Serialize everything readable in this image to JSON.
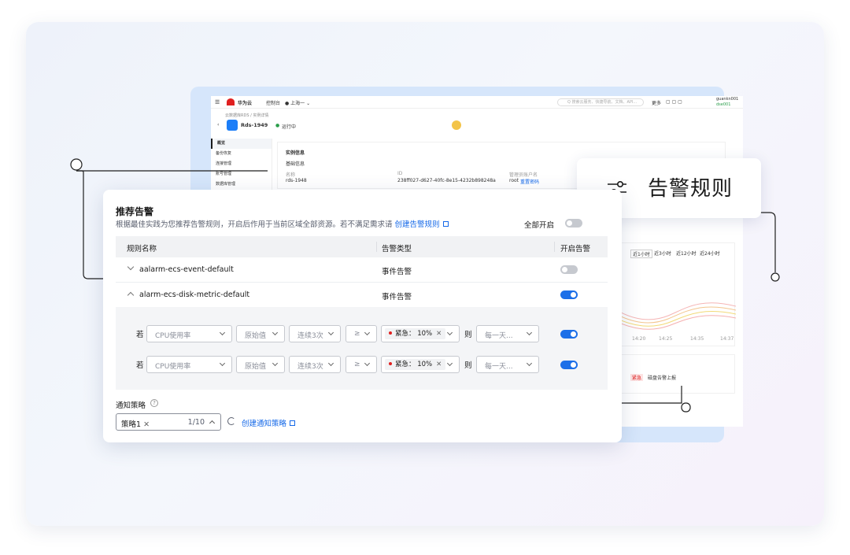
{
  "console": {
    "brand": "华为云",
    "nav_console": "控制台",
    "region": "上海一",
    "search_placeholder": "Q 搜索云服务、快捷导航、文档、API...",
    "more": "更多",
    "user_name": "guankn001",
    "user_sub": "dse001",
    "breadcrumb": "云数据库RDS / 实例详情",
    "instance_name": "Rds-1949",
    "status": "运行中",
    "sidebar": [
      "概览",
      "备份恢复",
      "连接管理",
      "账号管理",
      "数据库管理"
    ],
    "section_title": "实例信息",
    "subsection": "基础信息",
    "field_name_label": "名称",
    "field_name_value": "rds-1948",
    "field_id_label": "ID",
    "field_id_value": "238ff027-d627-40fc-8e15-4232b898248a",
    "field_admin_label": "管理员账户名",
    "field_admin_value": "root",
    "reset_pwd": "重置密码",
    "chart_tabs": [
      "近1小时",
      "近3小时",
      "近12小时",
      "近24小时"
    ],
    "chart_ticks": [
      "14:20",
      "14:25",
      "14:35",
      "14:37"
    ],
    "event_tag": "紧急",
    "event_text": "磁盘告警上报"
  },
  "callout": {
    "label": "告警规则",
    "icon": "sliders-icon"
  },
  "panel": {
    "title": "推荐告警",
    "description": "根据最佳实践为您推荐告警规则，开启后作用于当前区域全部资源。若不满足需求请",
    "create_rule_link": "创建告警规则",
    "enable_all_label": "全部开启",
    "enable_all_on": false,
    "columns": [
      "规则名称",
      "告警类型",
      "开启告警"
    ],
    "rules": [
      {
        "name": "aalarm-ecs-event-default",
        "type": "事件告警",
        "enabled": false,
        "expanded": false
      },
      {
        "name": "alarm-ecs-disk-metric-default",
        "type": "事件告警",
        "enabled": true,
        "expanded": true
      }
    ],
    "conditions": [
      {
        "if_label": "若",
        "metric": "CPU使用率",
        "stat": "原始值",
        "period": "连续3次",
        "op": "≥",
        "level": "紧急",
        "threshold": "10%",
        "then_label": "则",
        "action": "每一天...",
        "enabled": true
      },
      {
        "if_label": "若",
        "metric": "CPU使用率",
        "stat": "原始值",
        "period": "连续3次",
        "op": "≥",
        "level": "紧急",
        "threshold": "10%",
        "then_label": "则",
        "action": "每一天...",
        "enabled": true
      }
    ],
    "notify_label": "通知策略",
    "policy_tag": "策略1",
    "policy_count": "1/10",
    "create_notify_link": "创建通知策略"
  }
}
